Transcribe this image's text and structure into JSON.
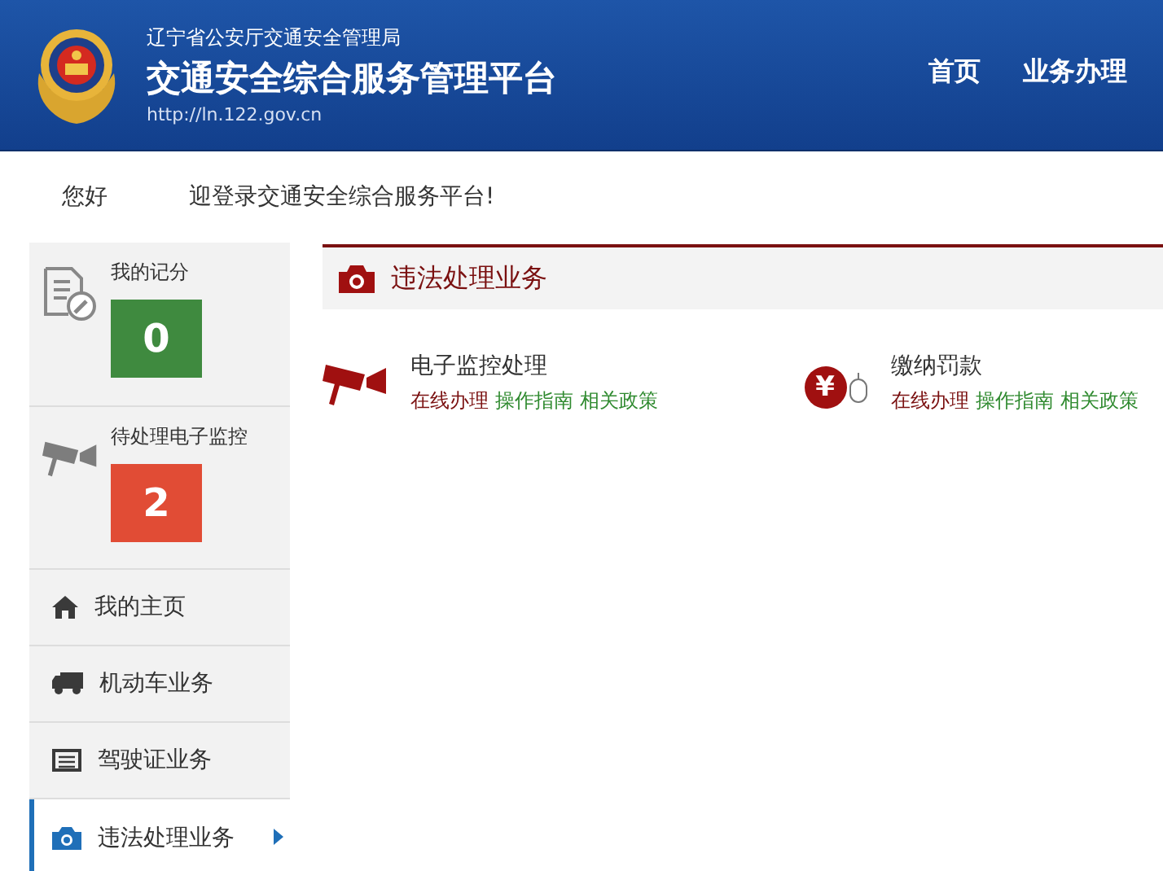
{
  "header": {
    "agency": "辽宁省公安厅交通安全管理局",
    "title": "交通安全综合服务管理平台",
    "url": "http://ln.122.gov.cn",
    "nav": [
      {
        "label": "首页"
      },
      {
        "label": "业务办理"
      }
    ]
  },
  "greeting": {
    "hello": "您好",
    "message": "迎登录交通安全综合服务平台!"
  },
  "sidebar": {
    "stats": [
      {
        "kind": "score",
        "label": "我的记分",
        "value": "0",
        "color": "#3f8a3f"
      },
      {
        "kind": "camera",
        "label": "待处理电子监控",
        "value": "2",
        "color": "#e14c35"
      }
    ],
    "items": [
      {
        "kind": "home",
        "label": "我的主页",
        "selected": false
      },
      {
        "kind": "vehicle",
        "label": "机动车业务",
        "selected": false
      },
      {
        "kind": "license",
        "label": "驾驶证业务",
        "selected": false
      },
      {
        "kind": "violation",
        "label": "违法处理业务",
        "selected": true
      }
    ]
  },
  "section": {
    "title": "违法处理业务",
    "services": [
      {
        "kind": "camera",
        "title": "电子监控处理",
        "links": [
          {
            "label": "在线办理",
            "kind": "primary"
          },
          {
            "label": "操作指南",
            "kind": "secondary"
          },
          {
            "label": "相关政策",
            "kind": "secondary"
          }
        ]
      },
      {
        "kind": "fine",
        "icon_text": "¥",
        "title": "缴纳罚款",
        "links": [
          {
            "label": "在线办理",
            "kind": "primary"
          },
          {
            "label": "操作指南",
            "kind": "secondary"
          },
          {
            "label": "相关政策",
            "kind": "secondary"
          }
        ]
      }
    ]
  }
}
